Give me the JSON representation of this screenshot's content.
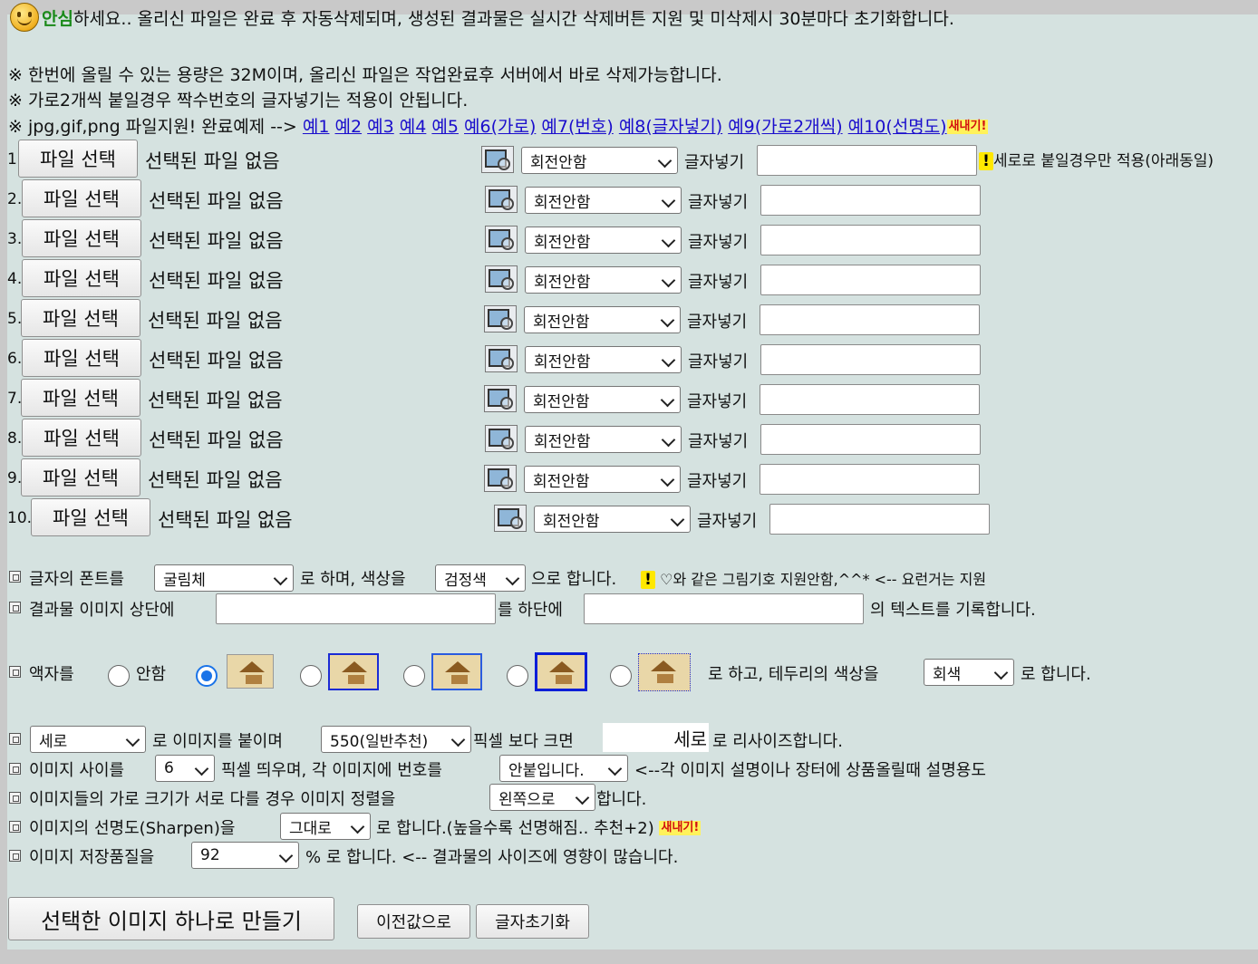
{
  "header": {
    "greeting_strong": "안심",
    "greeting_rest": "하세요.. 올리신 파일은 완료 후 자동삭제되며, 생성된 결과물은 실시간 삭제버튼 지원 및 미삭제시 30분마다 초기화합니다.",
    "notice1": "※ 한번에 올릴 수 있는 용량은 32M이며, 올리신 파일은 작업완료후 서버에서 바로 삭제가능합니다.",
    "notice2": "※ 가로2개씩 붙일경우 짝수번호의 글자넣기는 적용이 안됩니다.",
    "notice3_prefix": "※ jpg,gif,png 파일지원! 완료예제 -->",
    "examples": [
      "예1",
      "예2",
      "예3",
      "예4",
      "예5",
      "예6(가로)",
      "예7(번호)",
      "예8(글자넣기)",
      "예9(가로2개씩)",
      "예10(선명도)"
    ],
    "new_badge": "새내기!"
  },
  "uploads": {
    "choose_label": "파일 선택",
    "no_file_label": "선택된 파일 없음",
    "rotate_value": "회전안함",
    "text_label": "글자넣기",
    "first_note": "세로로 붙일경우만 적용(아래동일)",
    "numbers": [
      "1.",
      "2.",
      "3.",
      "4.",
      "5.",
      "6.",
      "7.",
      "8.",
      "9.",
      "10."
    ]
  },
  "font_row": {
    "label": "글자의 폰트를",
    "font_value": "굴림체",
    "mid": "로 하며, 색상을",
    "color_value": "검정색",
    "after": "으로 합니다.",
    "note": "♡와 같은 그림기호 지원안함,^^* <-- 요런거는 지원"
  },
  "header_footer_row": {
    "label": "결과물 이미지 상단에",
    "mid": "를 하단에",
    "after": "의 텍스트를 기록합니다."
  },
  "frame_row": {
    "label": "액자를",
    "none_label": "안함",
    "after": "로 하고, 테두리의 색상을",
    "border_color": "회색",
    "end": "로 합니다."
  },
  "direction_row": {
    "direction_value": "세로",
    "text1": "로 이미지를 붙이며",
    "size_value": "550(일반추천)",
    "text2": "픽셀 보다 크면",
    "resize_word": "세로",
    "text3": "로 리사이즈합니다."
  },
  "spacing_row": {
    "label": "이미지 사이를",
    "spacing_value": "6",
    "text1": "픽셀 띄우며, 각 이미지에 번호를",
    "number_value": "안붙입니다.",
    "text2": "<--각 이미지 설명이나 장터에 상품올릴때 설명용도"
  },
  "align_row": {
    "label": "이미지들의 가로 크기가 서로 다를 경우 이미지 정렬을",
    "align_value": "왼쪽으로",
    "after": "합니다."
  },
  "sharpen_row": {
    "label": "이미지의 선명도(Sharpen)을",
    "sharpen_value": "그대로",
    "after": "로 합니다.(높을수록 선명해짐.. 추천+2)"
  },
  "quality_row": {
    "label": "이미지 저장품질을",
    "quality_value": "92",
    "after": "% 로 합니다. <-- 결과물의 사이즈에 영향이 많습니다."
  },
  "actions": {
    "make_label": "선택한 이미지 하나로 만들기",
    "prev_label": "이전값으로",
    "reset_label": "글자초기화"
  }
}
